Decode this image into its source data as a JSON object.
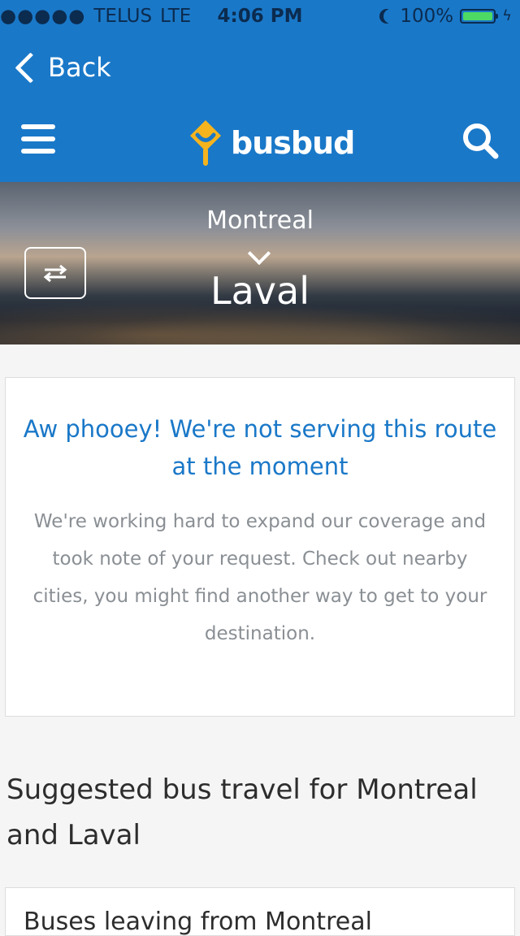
{
  "status_bar": {
    "signal": "●●●●●",
    "carrier": "TELUS",
    "network": "LTE",
    "time": "4:06 PM",
    "battery": "100%"
  },
  "nav": {
    "back_label": "Back",
    "brand": "busbud"
  },
  "route": {
    "origin": "Montreal",
    "destination": "Laval"
  },
  "notice": {
    "title": "Aw phooey! We're not serving this route at the moment",
    "body": "We're working hard to expand our coverage and took note of your request. Check out nearby cities, you might find another way to get to your destination."
  },
  "suggestions": {
    "heading": "Suggested bus travel for Montreal and Laval",
    "first_card_title": "Buses leaving from Montreal"
  },
  "colors": {
    "brand_blue": "#1a78c8",
    "logo_yellow": "#f5b41e",
    "battery_green": "#4cd964"
  },
  "icons": {
    "menu": "hamburger-icon",
    "search": "search-icon",
    "swap": "swap-arrows-icon",
    "back": "chevron-left-icon",
    "expand": "chevron-down-icon"
  }
}
